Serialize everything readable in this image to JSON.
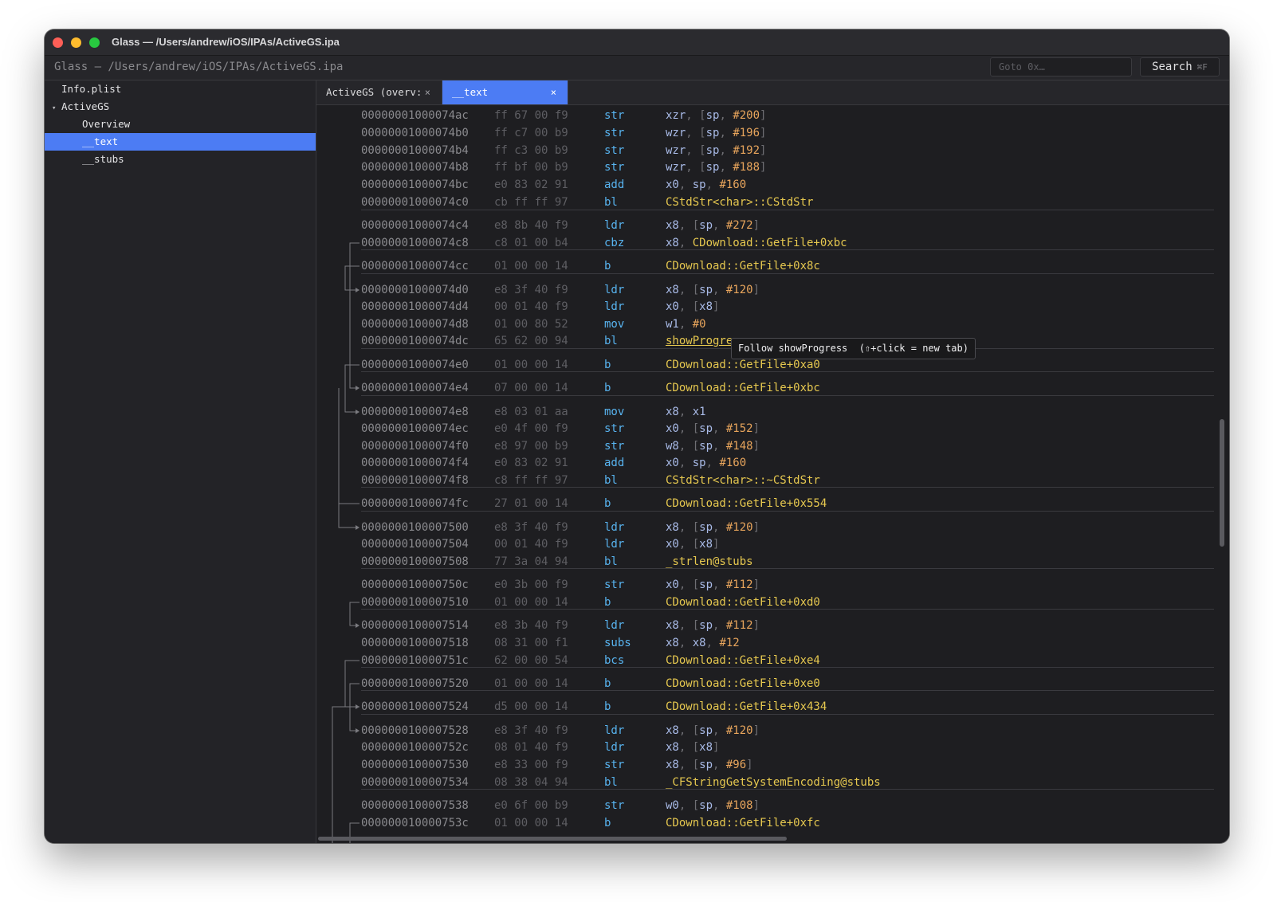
{
  "window": {
    "title": "Glass — /Users/andrew/iOS/IPAs/ActiveGS.ipa"
  },
  "toolbar": {
    "path": "Glass — /Users/andrew/iOS/IPAs/ActiveGS.ipa",
    "goto_placeholder": "Goto 0x…",
    "search_label": "Search",
    "search_shortcut": "⌘F"
  },
  "sidebar": {
    "items": [
      {
        "label": "Info.plist",
        "level": 0,
        "caret": "",
        "selected": false
      },
      {
        "label": "ActiveGS",
        "level": 0,
        "caret": "▾",
        "selected": false
      },
      {
        "label": "Overview",
        "level": 1,
        "caret": "",
        "selected": false
      },
      {
        "label": "__text",
        "level": 1,
        "caret": "",
        "selected": true
      },
      {
        "label": "__stubs",
        "level": 1,
        "caret": "",
        "selected": false
      }
    ]
  },
  "tabs": [
    {
      "label": "ActiveGS (overv:",
      "close": "×",
      "active": false
    },
    {
      "label": "__text",
      "close": "×",
      "active": true
    }
  ],
  "tooltip": {
    "text": "Follow showProgress  (⇧+click = new tab)"
  },
  "code": {
    "lines": [
      {
        "addr": "00000001000074ac",
        "bytes": "ff 67 00 f9",
        "mnem": "str",
        "ops": [
          [
            "reg",
            "xzr"
          ],
          [
            "punct",
            ", ["
          ],
          [
            "reg",
            "sp"
          ],
          [
            "punct",
            ", "
          ],
          [
            "imm",
            "#200"
          ],
          [
            "punct",
            "]"
          ]
        ]
      },
      {
        "addr": "00000001000074b0",
        "bytes": "ff c7 00 b9",
        "mnem": "str",
        "ops": [
          [
            "reg",
            "wzr"
          ],
          [
            "punct",
            ", ["
          ],
          [
            "reg",
            "sp"
          ],
          [
            "punct",
            ", "
          ],
          [
            "imm",
            "#196"
          ],
          [
            "punct",
            "]"
          ]
        ]
      },
      {
        "addr": "00000001000074b4",
        "bytes": "ff c3 00 b9",
        "mnem": "str",
        "ops": [
          [
            "reg",
            "wzr"
          ],
          [
            "punct",
            ", ["
          ],
          [
            "reg",
            "sp"
          ],
          [
            "punct",
            ", "
          ],
          [
            "imm",
            "#192"
          ],
          [
            "punct",
            "]"
          ]
        ]
      },
      {
        "addr": "00000001000074b8",
        "bytes": "ff bf 00 b9",
        "mnem": "str",
        "ops": [
          [
            "reg",
            "wzr"
          ],
          [
            "punct",
            ", ["
          ],
          [
            "reg",
            "sp"
          ],
          [
            "punct",
            ", "
          ],
          [
            "imm",
            "#188"
          ],
          [
            "punct",
            "]"
          ]
        ]
      },
      {
        "addr": "00000001000074bc",
        "bytes": "e0 83 02 91",
        "mnem": "add",
        "ops": [
          [
            "reg",
            "x0"
          ],
          [
            "punct",
            ", "
          ],
          [
            "reg",
            "sp"
          ],
          [
            "punct",
            ", "
          ],
          [
            "imm",
            "#160"
          ]
        ]
      },
      {
        "addr": "00000001000074c0",
        "bytes": "cb ff ff 97",
        "mnem": "bl",
        "ops": [
          [
            "sym",
            "CStdStr<char>::CStdStr"
          ]
        ]
      },
      {
        "addr": "00000001000074c4",
        "bytes": "e8 8b 40 f9",
        "mnem": "ldr",
        "ops": [
          [
            "reg",
            "x8"
          ],
          [
            "punct",
            ", ["
          ],
          [
            "reg",
            "sp"
          ],
          [
            "punct",
            ", "
          ],
          [
            "imm",
            "#272"
          ],
          [
            "punct",
            "]"
          ]
        ]
      },
      {
        "addr": "00000001000074c8",
        "bytes": "c8 01 00 b4",
        "mnem": "cbz",
        "ops": [
          [
            "reg",
            "x8"
          ],
          [
            "punct",
            ", "
          ],
          [
            "sym",
            "CDownload::GetFile+0xbc"
          ]
        ]
      },
      {
        "addr": "00000001000074cc",
        "bytes": "01 00 00 14",
        "mnem": "b",
        "ops": [
          [
            "sym",
            "CDownload::GetFile+0x8c"
          ]
        ]
      },
      {
        "addr": "00000001000074d0",
        "bytes": "e8 3f 40 f9",
        "mnem": "ldr",
        "ops": [
          [
            "reg",
            "x8"
          ],
          [
            "punct",
            ", ["
          ],
          [
            "reg",
            "sp"
          ],
          [
            "punct",
            ", "
          ],
          [
            "imm",
            "#120"
          ],
          [
            "punct",
            "]"
          ]
        ]
      },
      {
        "addr": "00000001000074d4",
        "bytes": "00 01 40 f9",
        "mnem": "ldr",
        "ops": [
          [
            "reg",
            "x0"
          ],
          [
            "punct",
            ", ["
          ],
          [
            "reg",
            "x8"
          ],
          [
            "punct",
            "]"
          ]
        ]
      },
      {
        "addr": "00000001000074d8",
        "bytes": "01 00 80 52",
        "mnem": "mov",
        "ops": [
          [
            "reg",
            "w1"
          ],
          [
            "punct",
            ", "
          ],
          [
            "imm",
            "#0"
          ]
        ]
      },
      {
        "addr": "00000001000074dc",
        "bytes": "65 62 00 94",
        "mnem": "bl",
        "ops": [
          [
            "symh",
            "showProgress"
          ]
        ]
      },
      {
        "addr": "00000001000074e0",
        "bytes": "01 00 00 14",
        "mnem": "b",
        "ops": [
          [
            "sym",
            "CDownload::GetFile+0xa0"
          ]
        ]
      },
      {
        "addr": "00000001000074e4",
        "bytes": "07 00 00 14",
        "mnem": "b",
        "ops": [
          [
            "sym",
            "CDownload::GetFile+0xbc"
          ]
        ]
      },
      {
        "addr": "00000001000074e8",
        "bytes": "e8 03 01 aa",
        "mnem": "mov",
        "ops": [
          [
            "reg",
            "x8"
          ],
          [
            "punct",
            ", "
          ],
          [
            "reg",
            "x1"
          ]
        ]
      },
      {
        "addr": "00000001000074ec",
        "bytes": "e0 4f 00 f9",
        "mnem": "str",
        "ops": [
          [
            "reg",
            "x0"
          ],
          [
            "punct",
            ", ["
          ],
          [
            "reg",
            "sp"
          ],
          [
            "punct",
            ", "
          ],
          [
            "imm",
            "#152"
          ],
          [
            "punct",
            "]"
          ]
        ]
      },
      {
        "addr": "00000001000074f0",
        "bytes": "e8 97 00 b9",
        "mnem": "str",
        "ops": [
          [
            "reg",
            "w8"
          ],
          [
            "punct",
            ", ["
          ],
          [
            "reg",
            "sp"
          ],
          [
            "punct",
            ", "
          ],
          [
            "imm",
            "#148"
          ],
          [
            "punct",
            "]"
          ]
        ]
      },
      {
        "addr": "00000001000074f4",
        "bytes": "e0 83 02 91",
        "mnem": "add",
        "ops": [
          [
            "reg",
            "x0"
          ],
          [
            "punct",
            ", "
          ],
          [
            "reg",
            "sp"
          ],
          [
            "punct",
            ", "
          ],
          [
            "imm",
            "#160"
          ]
        ]
      },
      {
        "addr": "00000001000074f8",
        "bytes": "c8 ff ff 97",
        "mnem": "bl",
        "ops": [
          [
            "sym",
            "CStdStr<char>::~CStdStr"
          ]
        ]
      },
      {
        "addr": "00000001000074fc",
        "bytes": "27 01 00 14",
        "mnem": "b",
        "ops": [
          [
            "sym",
            "CDownload::GetFile+0x554"
          ]
        ]
      },
      {
        "addr": "0000000100007500",
        "bytes": "e8 3f 40 f9",
        "mnem": "ldr",
        "ops": [
          [
            "reg",
            "x8"
          ],
          [
            "punct",
            ", ["
          ],
          [
            "reg",
            "sp"
          ],
          [
            "punct",
            ", "
          ],
          [
            "imm",
            "#120"
          ],
          [
            "punct",
            "]"
          ]
        ]
      },
      {
        "addr": "0000000100007504",
        "bytes": "00 01 40 f9",
        "mnem": "ldr",
        "ops": [
          [
            "reg",
            "x0"
          ],
          [
            "punct",
            ", ["
          ],
          [
            "reg",
            "x8"
          ],
          [
            "punct",
            "]"
          ]
        ]
      },
      {
        "addr": "0000000100007508",
        "bytes": "77 3a 04 94",
        "mnem": "bl",
        "ops": [
          [
            "sym",
            "_strlen@stubs"
          ]
        ]
      },
      {
        "addr": "000000010000750c",
        "bytes": "e0 3b 00 f9",
        "mnem": "str",
        "ops": [
          [
            "reg",
            "x0"
          ],
          [
            "punct",
            ", ["
          ],
          [
            "reg",
            "sp"
          ],
          [
            "punct",
            ", "
          ],
          [
            "imm",
            "#112"
          ],
          [
            "punct",
            "]"
          ]
        ]
      },
      {
        "addr": "0000000100007510",
        "bytes": "01 00 00 14",
        "mnem": "b",
        "ops": [
          [
            "sym",
            "CDownload::GetFile+0xd0"
          ]
        ]
      },
      {
        "addr": "0000000100007514",
        "bytes": "e8 3b 40 f9",
        "mnem": "ldr",
        "ops": [
          [
            "reg",
            "x8"
          ],
          [
            "punct",
            ", ["
          ],
          [
            "reg",
            "sp"
          ],
          [
            "punct",
            ", "
          ],
          [
            "imm",
            "#112"
          ],
          [
            "punct",
            "]"
          ]
        ]
      },
      {
        "addr": "0000000100007518",
        "bytes": "08 31 00 f1",
        "mnem": "subs",
        "ops": [
          [
            "reg",
            "x8"
          ],
          [
            "punct",
            ", "
          ],
          [
            "reg",
            "x8"
          ],
          [
            "punct",
            ", "
          ],
          [
            "imm",
            "#12"
          ]
        ]
      },
      {
        "addr": "000000010000751c",
        "bytes": "62 00 00 54",
        "mnem": "bcs",
        "ops": [
          [
            "sym",
            "CDownload::GetFile+0xe4"
          ]
        ]
      },
      {
        "addr": "0000000100007520",
        "bytes": "01 00 00 14",
        "mnem": "b",
        "ops": [
          [
            "sym",
            "CDownload::GetFile+0xe0"
          ]
        ]
      },
      {
        "addr": "0000000100007524",
        "bytes": "d5 00 00 14",
        "mnem": "b",
        "ops": [
          [
            "sym",
            "CDownload::GetFile+0x434"
          ]
        ]
      },
      {
        "addr": "0000000100007528",
        "bytes": "e8 3f 40 f9",
        "mnem": "ldr",
        "ops": [
          [
            "reg",
            "x8"
          ],
          [
            "punct",
            ", ["
          ],
          [
            "reg",
            "sp"
          ],
          [
            "punct",
            ", "
          ],
          [
            "imm",
            "#120"
          ],
          [
            "punct",
            "]"
          ]
        ]
      },
      {
        "addr": "000000010000752c",
        "bytes": "08 01 40 f9",
        "mnem": "ldr",
        "ops": [
          [
            "reg",
            "x8"
          ],
          [
            "punct",
            ", ["
          ],
          [
            "reg",
            "x8"
          ],
          [
            "punct",
            "]"
          ]
        ]
      },
      {
        "addr": "0000000100007530",
        "bytes": "e8 33 00 f9",
        "mnem": "str",
        "ops": [
          [
            "reg",
            "x8"
          ],
          [
            "punct",
            ", ["
          ],
          [
            "reg",
            "sp"
          ],
          [
            "punct",
            ", "
          ],
          [
            "imm",
            "#96"
          ],
          [
            "punct",
            "]"
          ]
        ]
      },
      {
        "addr": "0000000100007534",
        "bytes": "08 38 04 94",
        "mnem": "bl",
        "ops": [
          [
            "sym",
            "_CFStringGetSystemEncoding@stubs"
          ]
        ]
      },
      {
        "addr": "0000000100007538",
        "bytes": "e0 6f 00 b9",
        "mnem": "str",
        "ops": [
          [
            "reg",
            "w0"
          ],
          [
            "punct",
            ", ["
          ],
          [
            "reg",
            "sp"
          ],
          [
            "punct",
            ", "
          ],
          [
            "imm",
            "#108"
          ],
          [
            "punct",
            "]"
          ]
        ]
      },
      {
        "addr": "000000010000753c",
        "bytes": "01 00 00 14",
        "mnem": "b",
        "ops": [
          [
            "sym",
            "CDownload::GetFile+0xfc"
          ]
        ]
      }
    ]
  }
}
